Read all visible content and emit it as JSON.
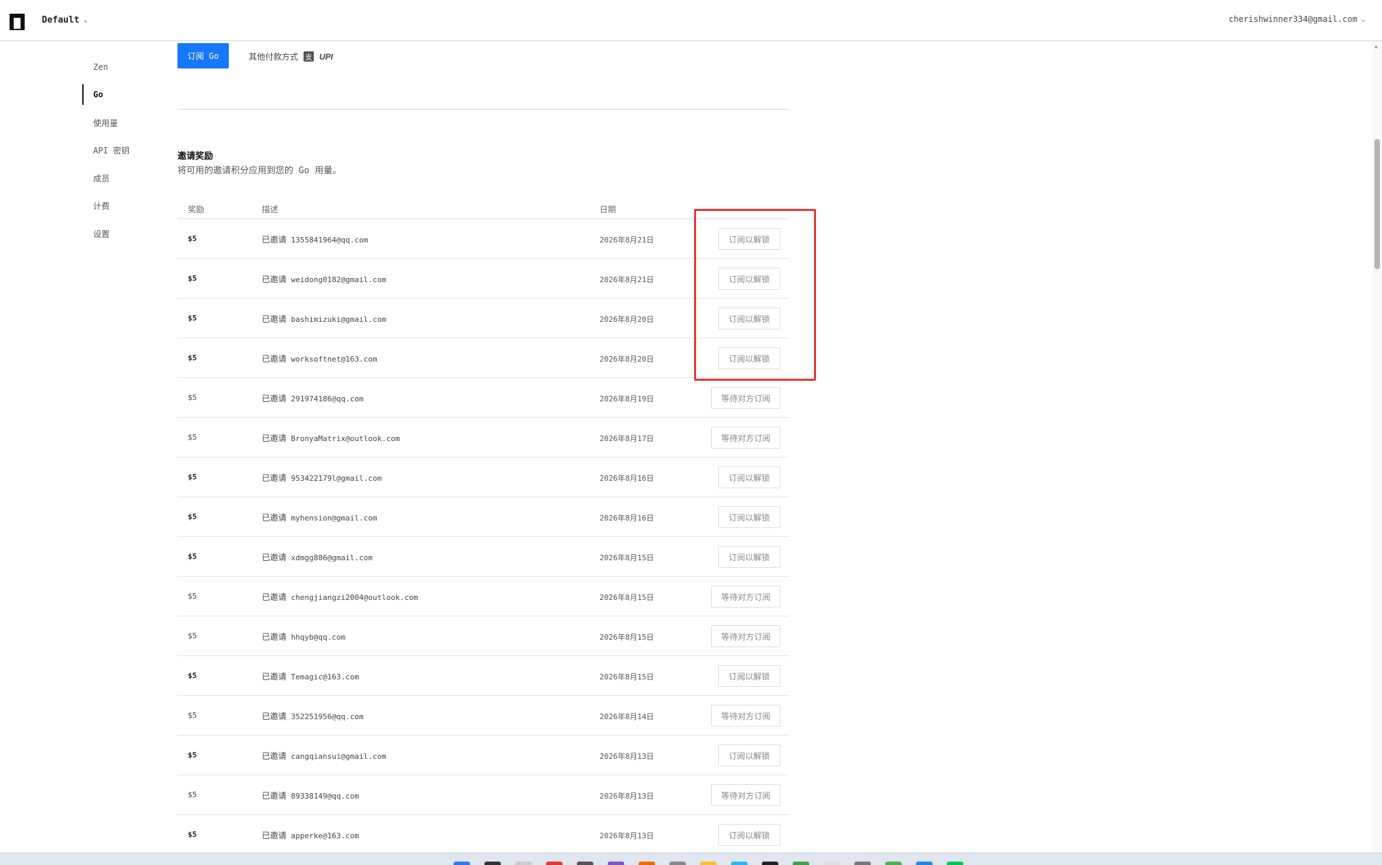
{
  "header": {
    "workspace": "Default",
    "account_email": "cherishwinner334@gmail.com"
  },
  "sidebar": {
    "items": [
      {
        "label": "Zen",
        "active": false
      },
      {
        "label": "Go",
        "active": true
      },
      {
        "label": "使用量",
        "active": false
      },
      {
        "label": "API 密钥",
        "active": false
      },
      {
        "label": "成员",
        "active": false
      },
      {
        "label": "计费",
        "active": false
      },
      {
        "label": "设置",
        "active": false
      }
    ]
  },
  "subscribe": {
    "button_label": "订阅 Go",
    "other_payment_label": "其他付款方式",
    "upi_label": "UPI"
  },
  "rewards": {
    "title": "邀请奖励",
    "description": "将可用的邀请积分应用到您的 Go 用量。",
    "columns": [
      "奖励",
      "描述",
      "日期"
    ],
    "invited_label": "已邀请",
    "rows": [
      {
        "amount": "$5",
        "email": "1355841964@qq.com",
        "date": "2026年8月21日",
        "action": "订阅以解锁",
        "status": "unlock"
      },
      {
        "amount": "$5",
        "email": "weidong0182@gmail.com",
        "date": "2026年8月21日",
        "action": "订阅以解锁",
        "status": "unlock"
      },
      {
        "amount": "$5",
        "email": "bashimizuki@gmail.com",
        "date": "2026年8月20日",
        "action": "订阅以解锁",
        "status": "unlock"
      },
      {
        "amount": "$5",
        "email": "worksoftnet@163.com",
        "date": "2026年8月20日",
        "action": "订阅以解锁",
        "status": "unlock"
      },
      {
        "amount": "$5",
        "email": "291974186@qq.com",
        "date": "2026年8月19日",
        "action": "等待对方订阅",
        "status": "wait"
      },
      {
        "amount": "$5",
        "email": "BronyaMatrix@outlook.com",
        "date": "2026年8月17日",
        "action": "等待对方订阅",
        "status": "wait"
      },
      {
        "amount": "$5",
        "email": "953422179l@gmail.com",
        "date": "2026年8月16日",
        "action": "订阅以解锁",
        "status": "unlock"
      },
      {
        "amount": "$5",
        "email": "myhension@gmail.com",
        "date": "2026年8月16日",
        "action": "订阅以解锁",
        "status": "unlock"
      },
      {
        "amount": "$5",
        "email": "xdmgg886@gmail.com",
        "date": "2026年8月15日",
        "action": "订阅以解锁",
        "status": "unlock"
      },
      {
        "amount": "$5",
        "email": "chengjiangzi2004@outlook.com",
        "date": "2026年8月15日",
        "action": "等待对方订阅",
        "status": "wait"
      },
      {
        "amount": "$5",
        "email": "hhqyb@qq.com",
        "date": "2026年8月15日",
        "action": "等待对方订阅",
        "status": "wait"
      },
      {
        "amount": "$5",
        "email": "Temagic@163.com",
        "date": "2026年8月15日",
        "action": "订阅以解锁",
        "status": "unlock"
      },
      {
        "amount": "$5",
        "email": "352251956@qq.com",
        "date": "2026年8月14日",
        "action": "等待对方订阅",
        "status": "wait"
      },
      {
        "amount": "$5",
        "email": "cangqiansui@gmail.com",
        "date": "2026年8月13日",
        "action": "订阅以解锁",
        "status": "unlock"
      },
      {
        "amount": "$5",
        "email": "89338149@qq.com",
        "date": "2026年8月13日",
        "action": "等待对方订阅",
        "status": "wait"
      },
      {
        "amount": "$5",
        "email": "apperke@163.com",
        "date": "2026年8月13日",
        "action": "订阅以解锁",
        "status": "unlock"
      }
    ]
  },
  "colors": {
    "accent": "#1677ff",
    "highlight": "#e53935"
  }
}
